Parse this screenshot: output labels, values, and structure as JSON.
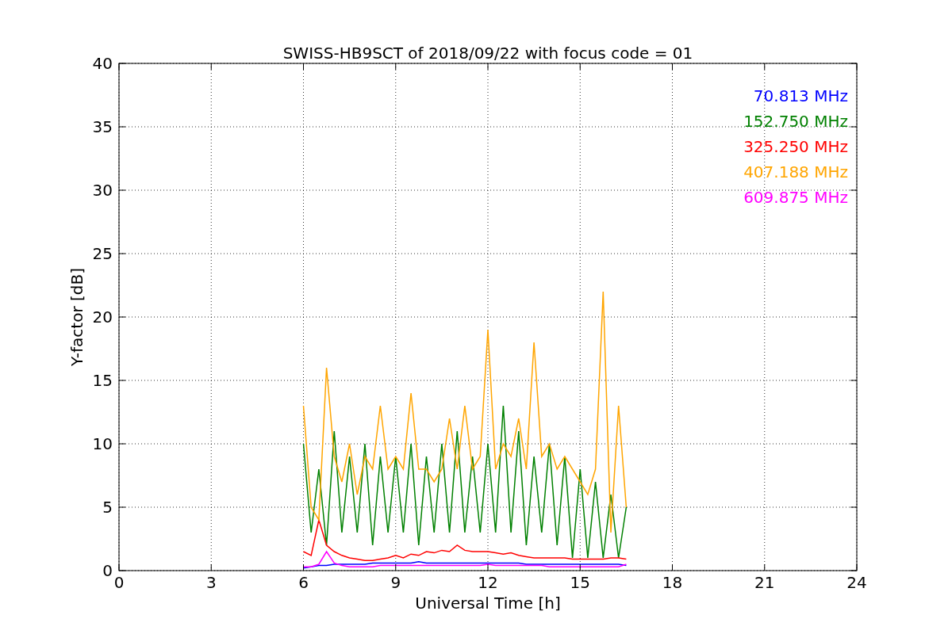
{
  "figure": {
    "chart_data": {
      "type": "line",
      "title": "SWISS-HB9SCT of 2018/09/22 with focus code = 01",
      "xlabel": "Universal Time [h]",
      "ylabel": "Y-factor [dB]",
      "x": [
        6,
        6.25,
        6.5,
        6.75,
        7,
        7.25,
        7.5,
        7.75,
        8,
        8.25,
        8.5,
        8.75,
        9,
        9.25,
        9.5,
        9.75,
        10,
        10.25,
        10.5,
        10.75,
        11,
        11.25,
        11.5,
        11.75,
        12,
        12.25,
        12.5,
        12.75,
        13,
        13.25,
        13.5,
        13.75,
        14,
        14.25,
        14.5,
        14.75,
        15,
        15.25,
        15.5,
        15.75,
        16,
        16.25,
        16.5
      ],
      "series": [
        {
          "name": "70.813 MHz",
          "color": "#0000ff",
          "values": [
            0.2,
            0.3,
            0.4,
            0.4,
            0.5,
            0.5,
            0.5,
            0.5,
            0.5,
            0.6,
            0.6,
            0.6,
            0.6,
            0.6,
            0.6,
            0.7,
            0.6,
            0.6,
            0.6,
            0.6,
            0.6,
            0.6,
            0.6,
            0.6,
            0.6,
            0.6,
            0.6,
            0.6,
            0.6,
            0.5,
            0.5,
            0.5,
            0.5,
            0.5,
            0.5,
            0.5,
            0.5,
            0.5,
            0.5,
            0.5,
            0.5,
            0.5,
            0.4
          ]
        },
        {
          "name": "152.750 MHz",
          "color": "#008000",
          "values": [
            10,
            3,
            8,
            2,
            11,
            3,
            9,
            3,
            10,
            2,
            9,
            3,
            9,
            3,
            10,
            2,
            9,
            3,
            10,
            3,
            11,
            3,
            9,
            3,
            10,
            3,
            13,
            3,
            11,
            2,
            9,
            3,
            10,
            2,
            9,
            1,
            8,
            1,
            7,
            1,
            6,
            1,
            5
          ]
        },
        {
          "name": "325.250 MHz",
          "color": "#ff0000",
          "values": [
            1.5,
            1.2,
            4,
            2,
            1.5,
            1.2,
            1.0,
            0.9,
            0.8,
            0.8,
            0.9,
            1.0,
            1.2,
            1.0,
            1.3,
            1.2,
            1.5,
            1.4,
            1.6,
            1.5,
            2.0,
            1.6,
            1.5,
            1.5,
            1.5,
            1.4,
            1.3,
            1.4,
            1.2,
            1.1,
            1.0,
            1.0,
            1.0,
            1.0,
            1.0,
            0.9,
            0.9,
            0.9,
            0.9,
            0.9,
            1.0,
            1.0,
            0.9
          ]
        },
        {
          "name": "407.188 MHz",
          "color": "#ffa500",
          "values": [
            13,
            5,
            4,
            16,
            9,
            7,
            10,
            6,
            9,
            8,
            13,
            8,
            9,
            8,
            14,
            8,
            8,
            7,
            8,
            12,
            8,
            13,
            8,
            9,
            19,
            8,
            10,
            9,
            12,
            8,
            18,
            9,
            10,
            8,
            9,
            8,
            7,
            6,
            8,
            22,
            3,
            13,
            5
          ]
        },
        {
          "name": "609.875 MHz",
          "color": "#ff00ff",
          "values": [
            0.3,
            0.3,
            0.5,
            1.5,
            0.6,
            0.4,
            0.3,
            0.3,
            0.3,
            0.3,
            0.4,
            0.4,
            0.4,
            0.4,
            0.4,
            0.4,
            0.4,
            0.4,
            0.4,
            0.4,
            0.4,
            0.4,
            0.4,
            0.4,
            0.5,
            0.4,
            0.4,
            0.4,
            0.4,
            0.4,
            0.4,
            0.4,
            0.3,
            0.3,
            0.3,
            0.3,
            0.3,
            0.3,
            0.3,
            0.3,
            0.3,
            0.3,
            0.5
          ]
        }
      ],
      "grid": true,
      "xlim": [
        0,
        24
      ],
      "ylim": [
        0,
        40
      ],
      "xticks": [
        0,
        3,
        6,
        9,
        12,
        15,
        18,
        21,
        24
      ],
      "yticks": [
        0,
        5,
        10,
        15,
        20,
        25,
        30,
        35,
        40
      ]
    }
  }
}
